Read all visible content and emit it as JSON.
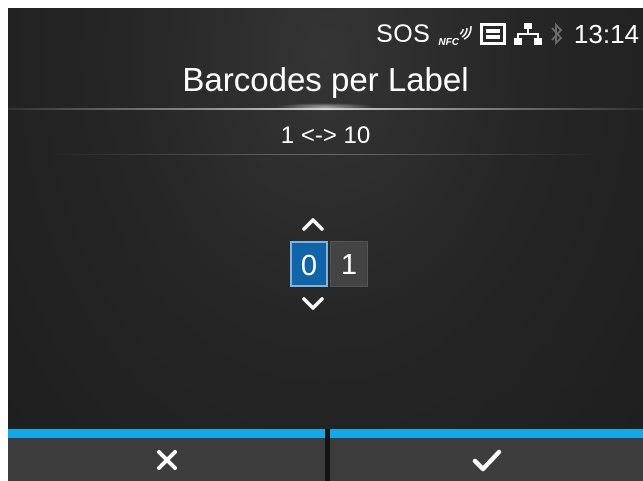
{
  "status_bar": {
    "sos_label": "SOS",
    "nfc_label": "NFC",
    "time": "13:14",
    "icons": [
      "nfc-icon",
      "sd-card-icon",
      "lan-icon",
      "bluetooth-icon"
    ]
  },
  "header": {
    "title": "Barcodes per Label",
    "range": "1 <-> 10"
  },
  "stepper": {
    "digits": [
      "0",
      "1"
    ],
    "selected_digit_index": 0,
    "up_icon": "chevron-up-icon",
    "down_icon": "chevron-down-icon"
  },
  "footer": {
    "cancel_icon": "close-icon",
    "ok_icon": "checkmark-icon"
  },
  "colors": {
    "accent": "#14a8e6",
    "selected_digit": "#1264a8",
    "background": "#262626",
    "button": "#3d3d3d"
  }
}
